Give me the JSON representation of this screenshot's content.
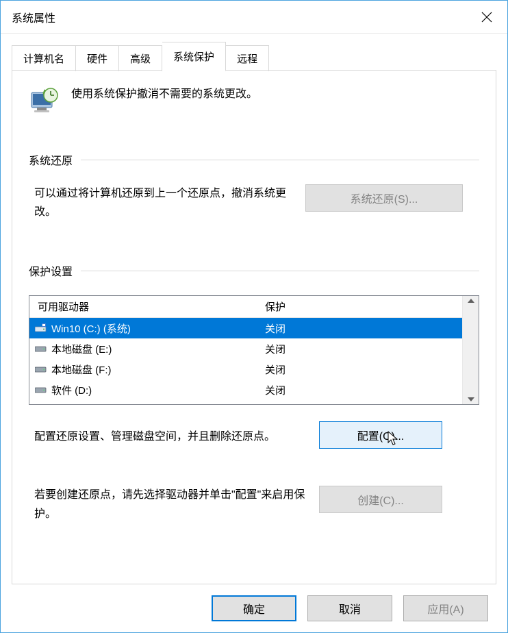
{
  "window": {
    "title": "系统属性"
  },
  "tabs": [
    {
      "label": "计算机名"
    },
    {
      "label": "硬件"
    },
    {
      "label": "高级"
    },
    {
      "label": "系统保护"
    },
    {
      "label": "远程"
    }
  ],
  "intro": {
    "text": "使用系统保护撤消不需要的系统更改。"
  },
  "restore": {
    "heading": "系统还原",
    "text": "可以通过将计算机还原到上一个还原点，撤消系统更改。",
    "button": "系统还原(S)..."
  },
  "protection": {
    "heading": "保护设置",
    "columns": {
      "drive": "可用驱动器",
      "prot": "保护"
    },
    "drives": [
      {
        "name": "Win10 (C:) (系统)",
        "status": "关闭",
        "selected": true,
        "sys": true
      },
      {
        "name": "本地磁盘 (E:)",
        "status": "关闭",
        "selected": false,
        "sys": false
      },
      {
        "name": "本地磁盘 (F:)",
        "status": "关闭",
        "selected": false,
        "sys": false
      },
      {
        "name": "软件 (D:)",
        "status": "关闭",
        "selected": false,
        "sys": false
      }
    ],
    "config_text": "配置还原设置、管理磁盘空间，并且删除还原点。",
    "config_button": "配置(O)...",
    "create_text": "若要创建还原点，请先选择驱动器并单击\"配置\"来启用保护。",
    "create_button": "创建(C)..."
  },
  "footer": {
    "ok": "确定",
    "cancel": "取消",
    "apply": "应用(A)"
  }
}
